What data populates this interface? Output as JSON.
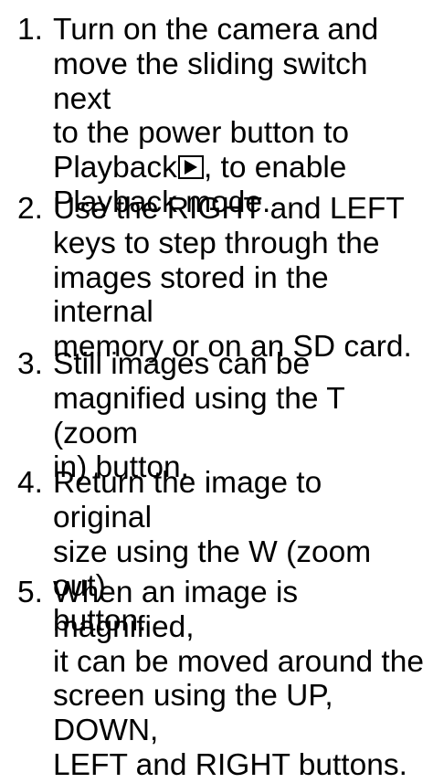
{
  "steps": [
    {
      "number": "1.",
      "line1": "Turn on the camera and",
      "line2": "move the sliding switch next",
      "line3": "to the power button to",
      "line4_before_icon": "Playback",
      "line4_after_icon": ", to enable",
      "line5": "Playback mode."
    },
    {
      "number": "2.",
      "line1": "Use the RIGHT and LEFT",
      "line2": "keys to step through the",
      "line3": "images stored in the internal",
      "line4": "memory or on an SD card."
    },
    {
      "number": "3.",
      "line1": "Still images can be",
      "line2": "magnified using the T (zoom",
      "line3": "in) button."
    },
    {
      "number": "4.",
      "line1": "Return the image to original",
      "line2": "size using the W (zoom out)",
      "line3": "button."
    },
    {
      "number": "5.",
      "line1": "When an image is magnified,",
      "line2": "it can be moved around the",
      "line3": "screen using the UP, DOWN,",
      "line4": "LEFT and RIGHT buttons."
    }
  ],
  "icons": {
    "playback": "play-icon"
  }
}
